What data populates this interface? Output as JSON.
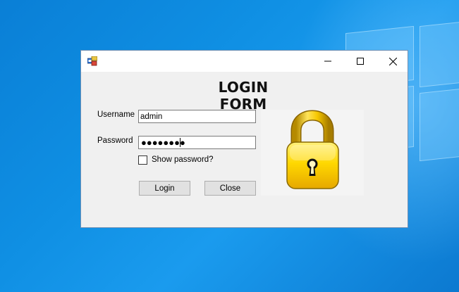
{
  "window": {
    "title": "",
    "form_title": "LOGIN FORM"
  },
  "form": {
    "username_label": "Username",
    "username_value": "admin",
    "password_label": "Password",
    "password_masked": "●●●●●●●●",
    "show_password_label": "Show password?",
    "show_password_checked": false,
    "login_button": "Login",
    "close_button": "Close"
  },
  "icons": {
    "app": "app-icon",
    "minimize": "minimize-icon",
    "maximize": "maximize-icon",
    "close": "close-icon",
    "lock": "padlock-icon"
  },
  "colors": {
    "desktop": "#0f8fe3",
    "window_bg": "#f0f0f0",
    "lock_yellow": "#f5c400"
  }
}
